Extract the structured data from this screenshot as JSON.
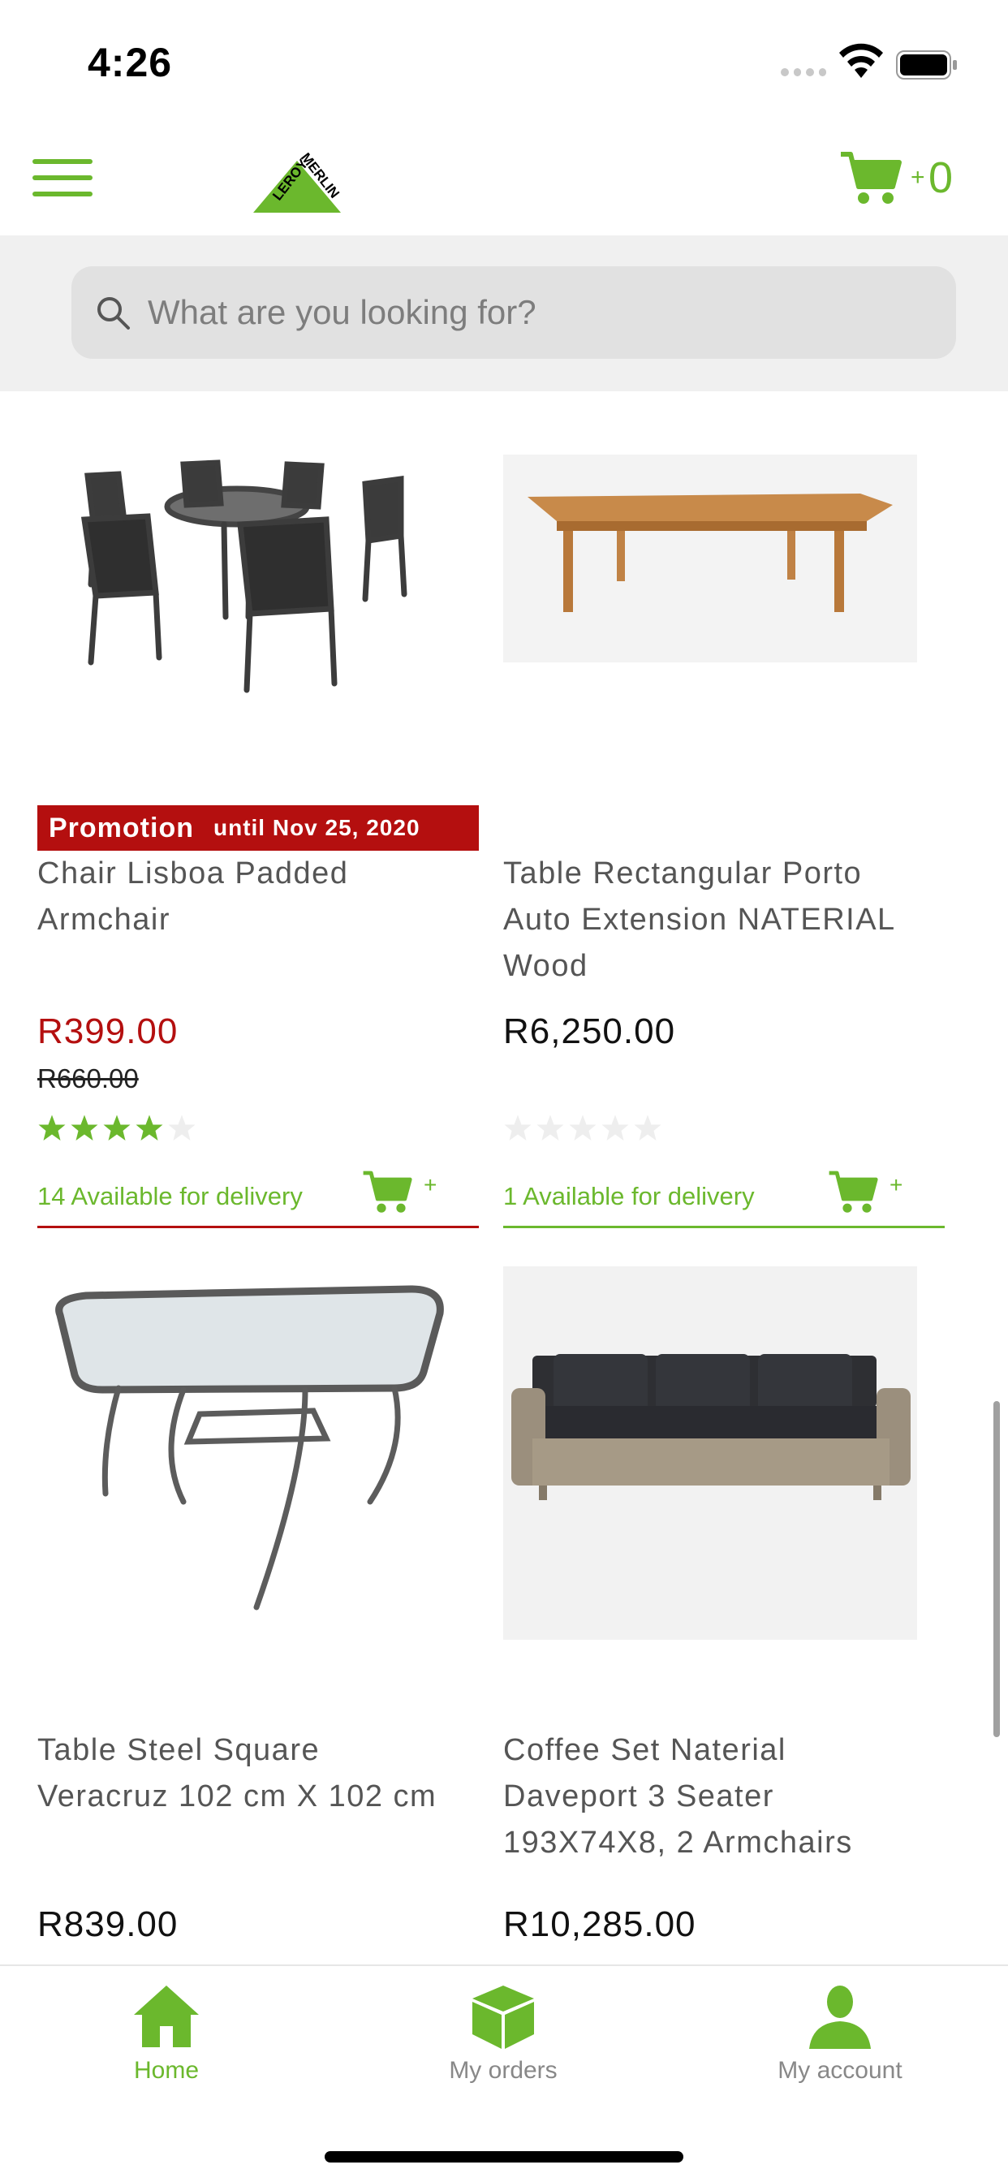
{
  "status_bar": {
    "time": "4:26"
  },
  "header": {
    "cart_plus": "+",
    "cart_count": "0",
    "logo_text": "LEROY MERLIN"
  },
  "search": {
    "placeholder": "What are you looking for?"
  },
  "products": [
    {
      "name_line1": "Chair Lisboa Padded",
      "name_line2": "Armchair",
      "promo_label": "Promotion",
      "promo_until": "until Nov 25, 2020",
      "price": "R399.00",
      "old_price": "R660.00",
      "rating": 4,
      "rating_max": 5,
      "delivery": "14 Available for delivery",
      "add_label": "+",
      "accent": "#b40f0f"
    },
    {
      "name_line1": "Table Rectangular Porto",
      "name_line2": "Auto Extension NATERIAL",
      "name_line3": "Wood",
      "price": "R6,250.00",
      "rating": 0,
      "rating_max": 5,
      "delivery": "1 Available for delivery",
      "add_label": "+",
      "accent": "#6bb82d"
    },
    {
      "name_line1": "Table Steel Square",
      "name_line2": "Veracruz 102 cm X 102 cm",
      "price": "R839.00"
    },
    {
      "name_line1": "Coffee Set Naterial",
      "name_line2": "Daveport 3 Seater",
      "name_line3": "193X74X8, 2 Armchairs",
      "price": "R10,285.00"
    }
  ],
  "bottom_nav": [
    {
      "label": "Home",
      "icon": "home-icon",
      "active": true
    },
    {
      "label": "My orders",
      "icon": "box-icon",
      "active": false
    },
    {
      "label": "My account",
      "icon": "person-icon",
      "active": false
    }
  ],
  "colors": {
    "brand_green": "#6bb82d",
    "promo_red": "#b40f0f",
    "search_band": "#f0f0f0"
  }
}
